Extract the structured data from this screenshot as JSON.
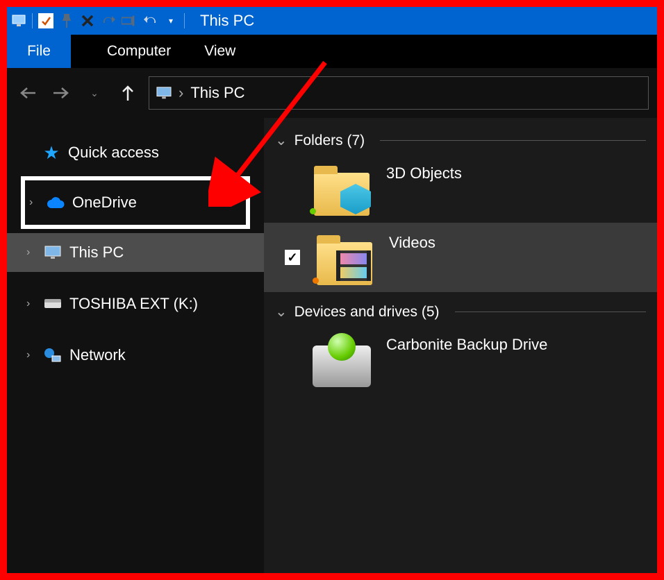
{
  "window": {
    "title": "This PC"
  },
  "ribbon": {
    "file": "File",
    "tabs": [
      "Computer",
      "View"
    ]
  },
  "address": {
    "location": "This PC"
  },
  "sidebar": {
    "quick_access": "Quick access",
    "onedrive": "OneDrive",
    "this_pc": "This PC",
    "drive_k": "TOSHIBA EXT (K:)",
    "network": "Network"
  },
  "content": {
    "folders_header": "Folders (7)",
    "devices_header": "Devices and drives (5)",
    "items": {
      "objects3d": "3D Objects",
      "videos": "Videos",
      "carbonite": "Carbonite Backup Drive"
    }
  }
}
